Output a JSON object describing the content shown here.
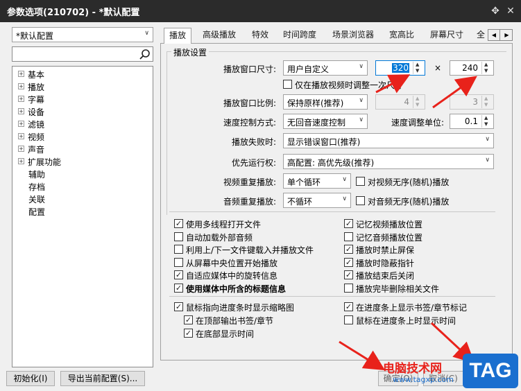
{
  "window": {
    "title": "参数选项(210702) - *默认配置",
    "pin_icon": "pin-icon",
    "close_icon": "close-icon"
  },
  "left": {
    "profile_value": "*默认配置",
    "search_value": "",
    "tree": [
      {
        "label": "基本",
        "expandable": true
      },
      {
        "label": "播放",
        "expandable": true
      },
      {
        "label": "字幕",
        "expandable": true
      },
      {
        "label": "设备",
        "expandable": true
      },
      {
        "label": "滤镜",
        "expandable": true
      },
      {
        "label": "视频",
        "expandable": true
      },
      {
        "label": "声音",
        "expandable": true
      },
      {
        "label": "扩展功能",
        "expandable": true
      },
      {
        "label": "辅助",
        "expandable": false
      },
      {
        "label": "存档",
        "expandable": false
      },
      {
        "label": "关联",
        "expandable": false
      },
      {
        "label": "配置",
        "expandable": false
      }
    ]
  },
  "tabs": [
    "播放",
    "高级播放",
    "特效",
    "时间跨度",
    "场景浏览器",
    "宽高比",
    "屏幕尺寸",
    "全"
  ],
  "group_title": "播放设置",
  "form": {
    "window_size_label": "播放窗口尺寸:",
    "window_size_value": "用户自定义",
    "width_value": "320",
    "times": "×",
    "height_value": "240",
    "only_adjust_label": "仅在播放视频时调整一次尺寸",
    "ratio_label": "播放窗口比例:",
    "ratio_value": "保持原样(推荐)",
    "ratio_w": "4",
    "ratio_h": "3",
    "speed_mode_label": "速度控制方式:",
    "speed_mode_value": "无回音速度控制",
    "speed_unit_label": "速度调整单位:",
    "speed_unit_value": "0.1",
    "fail_label": "播放失败时:",
    "fail_value": "显示错误窗口(推荐)",
    "priority_label": "优先运行权:",
    "priority_value": "高配置: 高优先级(推荐)",
    "video_repeat_label": "视频重复播放:",
    "video_repeat_value": "单个循环",
    "video_shuffle_label": "对视频无序(随机)播放",
    "audio_repeat_label": "音频重复播放:",
    "audio_repeat_value": "不循环",
    "audio_shuffle_label": "对音频无序(随机)播放"
  },
  "checks_left": [
    {
      "label": "使用多线程打开文件",
      "checked": true,
      "bold": false
    },
    {
      "label": "自动加载外部音频",
      "checked": false,
      "bold": false
    },
    {
      "label": "利用上/下一文件键载入并播放文件",
      "checked": false,
      "bold": false
    },
    {
      "label": "从屏幕中央位置开始播放",
      "checked": false,
      "bold": false
    },
    {
      "label": "自适应媒体中的旋转信息",
      "checked": true,
      "bold": false
    },
    {
      "label": "使用媒体中所含的标题信息",
      "checked": true,
      "bold": true
    }
  ],
  "checks_right": [
    {
      "label": "记忆视频播放位置",
      "checked": true
    },
    {
      "label": "记忆音频播放位置",
      "checked": false
    },
    {
      "label": "播放时禁止屏保",
      "checked": true
    },
    {
      "label": "播放时隐蔽指针",
      "checked": true
    },
    {
      "label": "播放结束后关闭",
      "checked": true
    },
    {
      "label": "播放完毕删除相关文件",
      "checked": false
    }
  ],
  "checks_bottom_left": [
    {
      "label": "鼠标指向进度条时显示缩略图",
      "checked": true,
      "indent": false
    },
    {
      "label": "在顶部输出书签/章节",
      "checked": true,
      "indent": true
    },
    {
      "label": "在底部显示时间",
      "checked": true,
      "indent": true
    }
  ],
  "checks_bottom_right": [
    {
      "label": "在进度条上显示书签/章节标记",
      "checked": true
    },
    {
      "label": "鼠标在进度条上时显示时间",
      "checked": false
    }
  ],
  "bottom": {
    "init_button": "初始化(I)",
    "export_button": "导出当前配置(S)...",
    "ok_button": "确定(O)",
    "cancel_button": "取消(C)"
  },
  "watermark": {
    "site_name": "电脑技术网",
    "url": "www.tagxp.com",
    "badge": "TAG"
  },
  "colors": {
    "titlebar": "#2b2b2b",
    "selection": "#0078d7",
    "arrow": "#e8221b",
    "badge": "#1a6fcf"
  }
}
